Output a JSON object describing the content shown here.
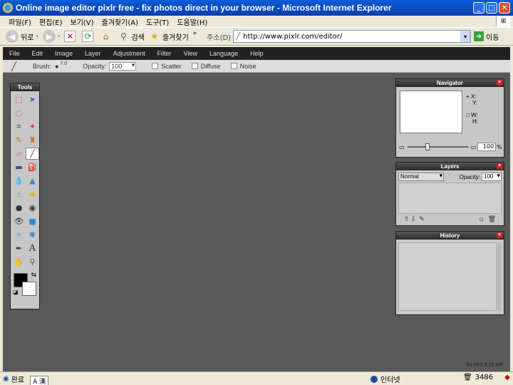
{
  "window": {
    "title": "Online image editor pixlr free - fix photos direct in your browser - Microsoft Internet Explorer",
    "min": "_",
    "max": "□",
    "close": "✕"
  },
  "ie_menu": [
    "파일(F)",
    "편집(E)",
    "보기(V)",
    "즐겨찾기(A)",
    "도구(T)",
    "도움말(H)"
  ],
  "ie_toolbar": {
    "back": "뒤로",
    "search": "검색",
    "favorites": "즐겨찾기",
    "address_label": "주소(D)",
    "url": "http://www.pixlr.com/editor/",
    "go": "이동",
    "more": "»"
  },
  "pixlr": {
    "menu": [
      "File",
      "Edit",
      "Image",
      "Layer",
      "Adjustment",
      "Filter",
      "View",
      "Language",
      "Help"
    ],
    "options": {
      "brush_label": "Brush:",
      "brush_size": "7.0",
      "opacity_label": "Opacity:",
      "opacity_value": "100",
      "scatter": "Scatter",
      "diffuse": "Diffuse",
      "noise": "Noise"
    },
    "tools_title": "Tools",
    "navigator": {
      "title": "Navigator",
      "x": "X:",
      "y": "Y:",
      "w": "W:",
      "h": "H:",
      "zoom": "100",
      "zoom_unit": "%",
      "zoom_level": 0.3
    },
    "layers": {
      "title": "Layers",
      "blend_mode": "Normal",
      "opacity_label": "Opacity:",
      "opacity_value": "100"
    },
    "history": {
      "title": "History"
    },
    "stats": "64 FPS 9.29 MB",
    "close": "×"
  },
  "statusbar": {
    "status": "완료",
    "ime": "A 漢",
    "zone": "인터넷",
    "memory": "3486"
  }
}
